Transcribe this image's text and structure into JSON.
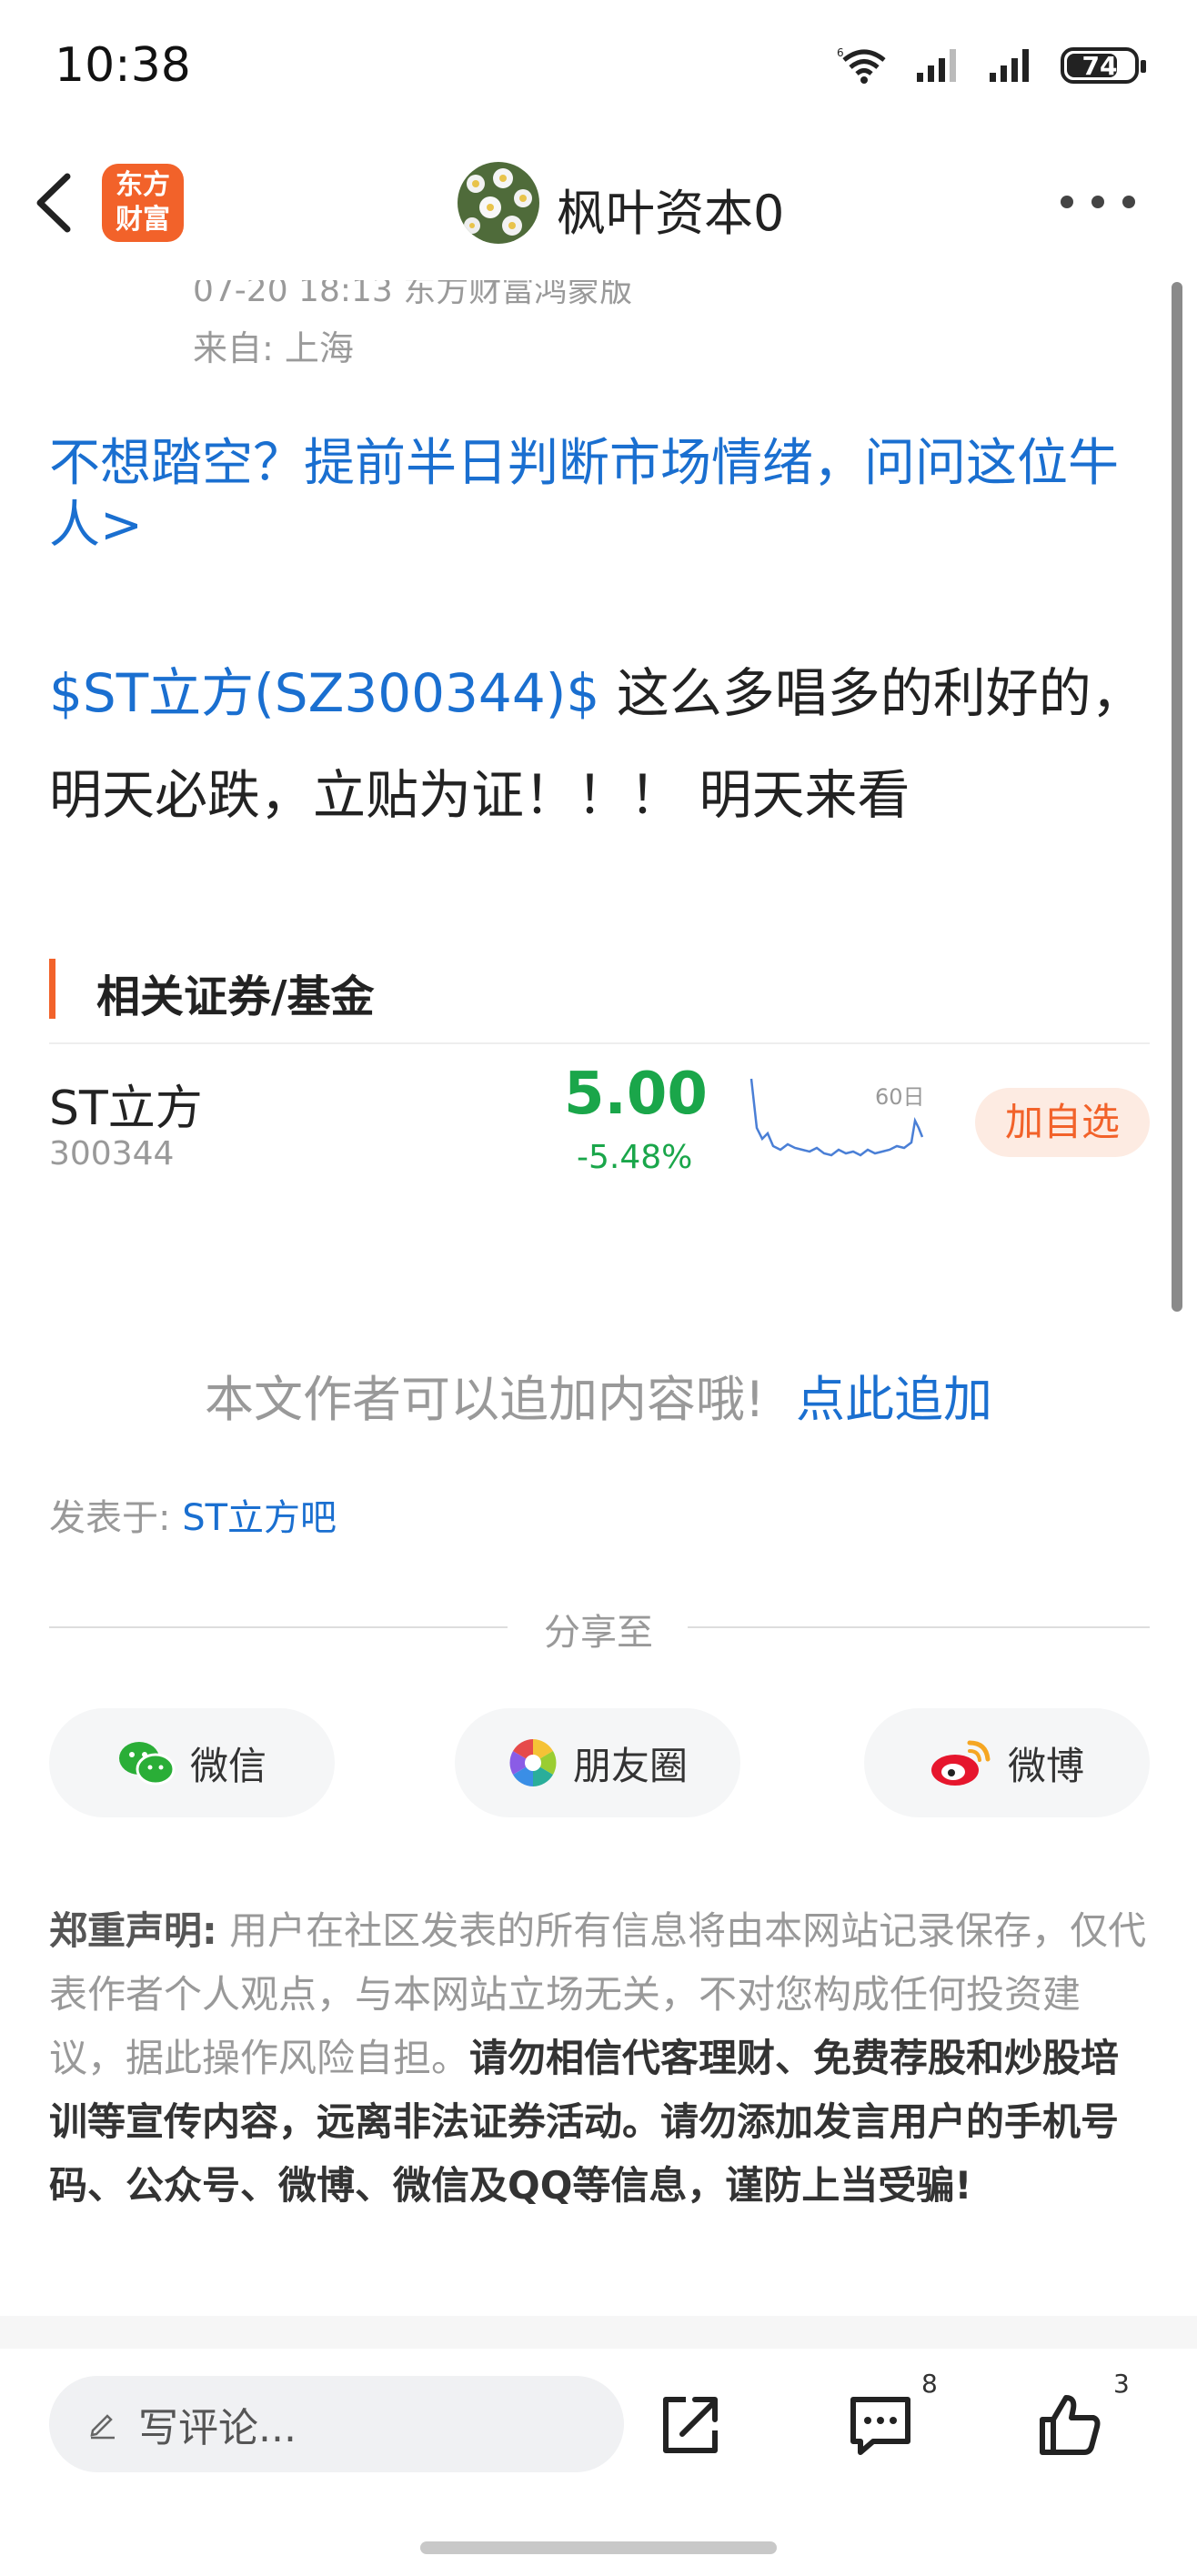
{
  "status_bar": {
    "time": "10:38",
    "battery": "74"
  },
  "header": {
    "logo_line1": "东方",
    "logo_line2": "财富",
    "title": "枫叶资本0"
  },
  "post_meta": {
    "datetime_source": "07-20 18:13 东方财富鸿蒙版",
    "location": "来自: 上海"
  },
  "ad_link": "不想踏空？提前半日判断市场情绪，问问这位牛人>",
  "post": {
    "stock_tag": "$ST立方(SZ300344)$",
    "text": " 这么多唱多的利好的，明天必跌，立贴为证！！！ 明天来看"
  },
  "related": {
    "title": "相关证券/基金",
    "stock": {
      "name": "ST立方",
      "code": "300344",
      "price": "5.00",
      "change": "-5.48%",
      "chart_label": "60日",
      "add_label": "加自选",
      "trend_color": "#1aa64a"
    }
  },
  "append": {
    "prompt": "本文作者可以追加内容哦!",
    "action": "点此追加"
  },
  "posted_in": {
    "prefix": "发表于: ",
    "bar": "ST立方吧"
  },
  "share": {
    "title": "分享至",
    "wechat": "微信",
    "moments": "朋友圈",
    "weibo": "微博"
  },
  "disclaimer": {
    "label": "郑重声明:",
    "normal": " 用户在社区发表的所有信息将由本网站记录保存，仅代表作者个人观点，与本网站立场无关，不对您构成任何投资建议，据此操作风险自担。",
    "strong": "请勿相信代客理财、免费荐股和炒股培训等宣传内容，远离非法证券活动。请勿添加发言用户的手机号码、公众号、微博、微信及QQ等信息，谨防上当受骗!"
  },
  "bottom_bar": {
    "comment_placeholder": "写评论...",
    "comment_count": "8",
    "like_count": "3"
  },
  "colors": {
    "accent": "#1a6fd0",
    "brand": "#f2622a",
    "down": "#1aa64a"
  }
}
